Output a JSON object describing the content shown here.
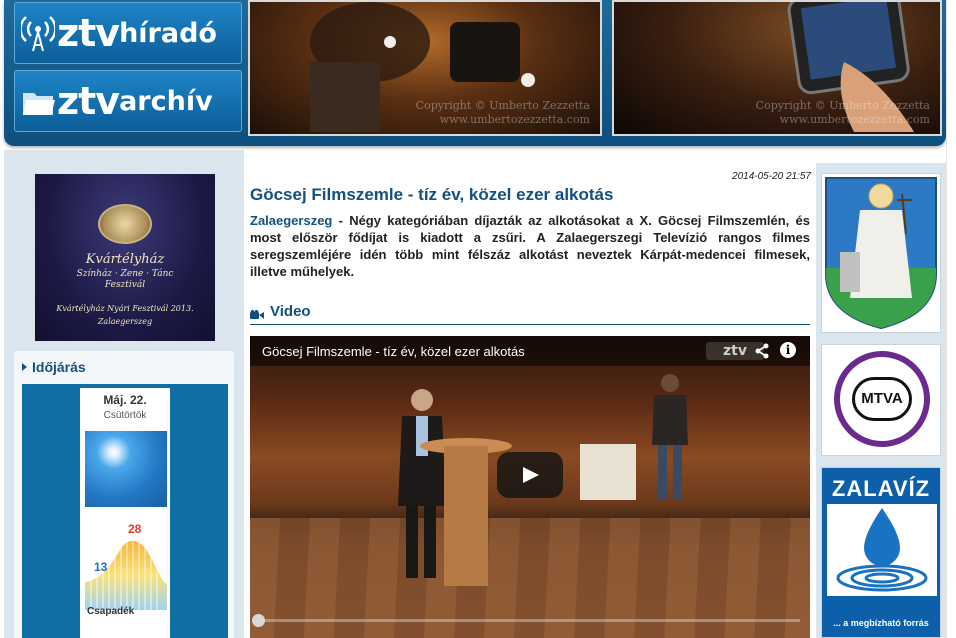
{
  "header": {
    "logo_hirado": {
      "ztv": "ztv",
      "rest": "híradó"
    },
    "logo_archiv": {
      "ztv": "ztv",
      "rest": "archív"
    },
    "photo_watermark_1": "Copyright © Umberto Zezzetta",
    "photo_watermark_2": "www.umbertozezzetta.com"
  },
  "left_sidebar": {
    "festival": {
      "title": "Kvártélyház",
      "subtitle_1": "Színház · Zene · Tánc",
      "subtitle_2": "Fesztivál",
      "footer_1": "Kvártélyház Nyári Fesztivál 2013.",
      "footer_2": "Zalaegerszeg"
    },
    "weather": {
      "title": "Időjárás",
      "date": "Máj. 22.",
      "day": "Csütörtök",
      "high": "28",
      "low": "13",
      "rain_label": "Csapadék",
      "colors": {
        "high": "#e23b24",
        "low": "#1f6cd0"
      }
    }
  },
  "article": {
    "date": "2014-05-20 21:57",
    "title": "Göcsej Filmszemle - tíz év, közel ezer alkotás",
    "lead_place": "Zalaegerszeg",
    "lead_text": " - Négy kategóriában díjazták az alkotásokat a X. Göcsej Filmszemlén, és most először fődíjat is kiadott a zsűri. A Zalaegerszegi Televízió rangos filmes seregszemléjére idén több mint félszáz alkotást neveztek Kárpát-medencei filmesek, illetve műhelyek.",
    "video_section_label": "Video",
    "player": {
      "title": "Göcsej Filmszemle - tíz év, közel ezer alkotás",
      "logo": "ztv",
      "progress": 0
    }
  },
  "right_sidebar": {
    "mtva": "MTVA",
    "zalaviz_title": "ZALAVÍZ",
    "zalaviz_tagline": "... a megbízható forrás"
  },
  "colors": {
    "brand_blue": "#14507f",
    "header_blue": "#0e4f7e",
    "mtva_purple": "#6b2a8e",
    "zalaviz_blue": "#0c5fa8"
  }
}
